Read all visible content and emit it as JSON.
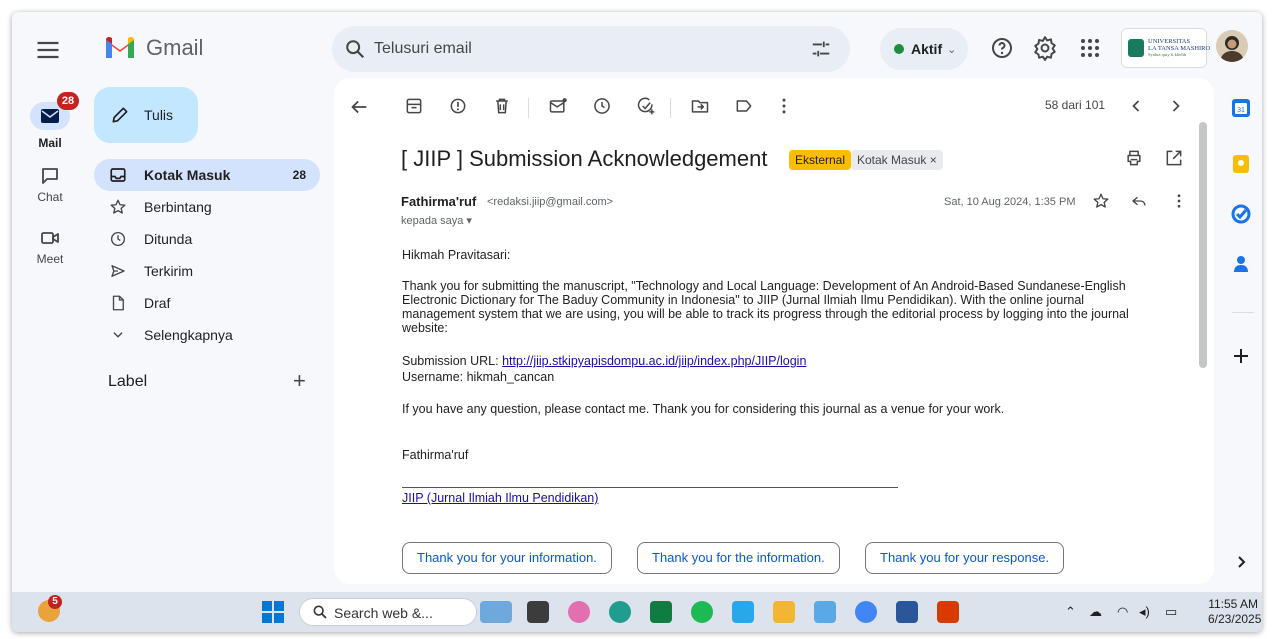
{
  "app": {
    "name": "Gmail"
  },
  "search": {
    "placeholder": "Telusuri email"
  },
  "status": {
    "label": "Aktif"
  },
  "org_logo": {
    "line1": "UNIVERSITAS",
    "line2": "LA TANSA MASHIRO",
    "tagline": "Syahra quiy fi kholik"
  },
  "rail": {
    "mail_label": "Mail",
    "mail_badge": "28",
    "chat_label": "Chat",
    "meet_label": "Meet"
  },
  "compose_label": "Tulis",
  "nav": [
    {
      "label": "Kotak Masuk",
      "count": "28",
      "icon": "inbox-icon"
    },
    {
      "label": "Berbintang",
      "icon": "star-icon"
    },
    {
      "label": "Ditunda",
      "icon": "clock-icon"
    },
    {
      "label": "Terkirim",
      "icon": "send-icon"
    },
    {
      "label": "Draf",
      "icon": "draft-icon"
    },
    {
      "label": "Selengkapnya",
      "icon": "chevron-down-icon"
    }
  ],
  "labels_heading": "Label",
  "toolbar": {
    "pager": "58 dari 101"
  },
  "email": {
    "subject": "[ JIIP ] Submission Acknowledgement",
    "tag_external": "Eksternal",
    "tag_inbox": "Kotak Masuk ×",
    "sender_name": "Fathirma'ruf",
    "sender_email": "<redaksi.jiip@gmail.com>",
    "to": "kepada saya ▾",
    "date": "Sat, 10 Aug 2024, 1:35 PM",
    "greeting": "Hikmah Pravitasari:",
    "paragraph1": "Thank you for submitting the manuscript, \"Technology and Local Language: Development of An Android-Based Sundanese-English Electronic Dictionary for The Baduy Community in Indonesia\" to JIIP (Jurnal Ilmiah Ilmu Pendidikan). With the online journal management system that we are using, you will be able to track its progress through the editorial process by logging into the journal website:",
    "url_label": "Submission URL:",
    "url": "http://jiip.stkipyapisdompu.ac.id/jiip/index.php/JIIP/login",
    "username": "Username: hikmah_cancan",
    "paragraph2": "If you have any question, please contact me. Thank you for considering this journal as a venue for your work.",
    "signoff": "Fathirma'ruf",
    "journal_link": "JIIP (Jurnal Ilmiah Ilmu Pendidikan)"
  },
  "smart_replies": [
    "Thank you for your information.",
    "Thank you for the information.",
    "Thank you for your response."
  ],
  "taskbar": {
    "weather_badge": "5",
    "search_text": "Search web &...",
    "time": "11:55 AM",
    "date": "6/23/2025"
  },
  "colors": {
    "accent": "#0b57d0",
    "nav_active": "#d3e3fd",
    "compose": "#c2e7ff",
    "badge": "#c5221f",
    "external_tag": "#fbbc04"
  }
}
